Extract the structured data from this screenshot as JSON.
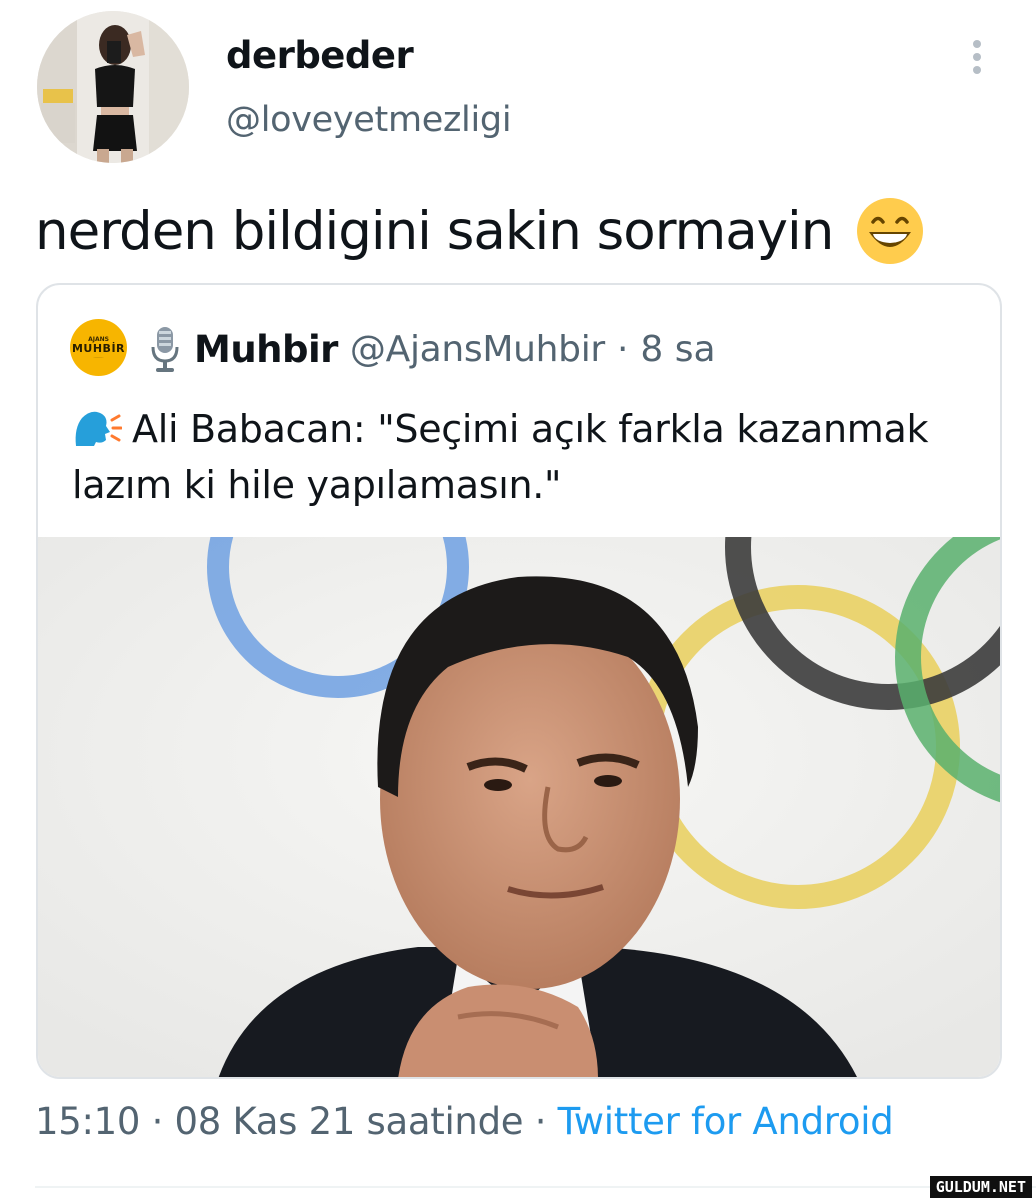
{
  "author": {
    "display_name": "derbeder",
    "handle": "@loveyetmezligi",
    "avatar": "profile-photo"
  },
  "tweet": {
    "text": "nerden bildigini sakin sormayin",
    "emoji": "grinning-face-with-smiling-eyes"
  },
  "quoted_tweet": {
    "avatar_lines": [
      "AJANS",
      "MUHBİR",
      "........."
    ],
    "name_icon": "microphone-icon",
    "name": "Muhbir",
    "handle": "@AjansMuhbir",
    "separator": "·",
    "time": "8 sa",
    "text_icon": "speaking-head-icon",
    "text": "Ali Babacan: \"Seçimi açık farkla kazanmak lazım ki hile yapılamasın.\"",
    "image": "portrait-photo"
  },
  "meta": {
    "timestamp": "15:10 · 08 Kas 21 saatinde · ",
    "source": "Twitter for Android"
  },
  "watermark": "GULDUM.NET",
  "colors": {
    "secondary_text": "#536471",
    "link": "#1d9bf0",
    "border": "#dfe3e7",
    "muhbir_brand": "#f7b500"
  }
}
